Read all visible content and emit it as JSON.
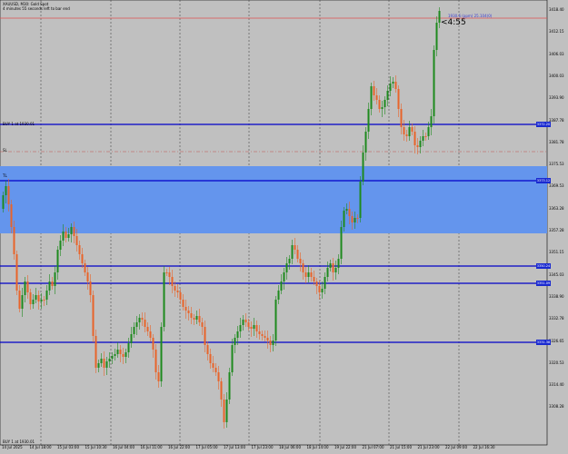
{
  "header": {
    "title": "XAUUSD, M30:  Gold Spot",
    "subtitle": "4 minutes 55 seconds left to bar end"
  },
  "countdown": "<4:55",
  "ask_note": "1930.6 (ppm) 25.104(0)",
  "lines": {
    "buy_label": "BUY 1 at 1930.01",
    "sl_label": "SL",
    "tp_label": "TL",
    "buy_bottom_label": "BUY 1 at 1930.01"
  },
  "price_axis": [
    {
      "value": "3418.40"
    },
    {
      "value": "3412.15"
    },
    {
      "value": "3406.03"
    },
    {
      "value": "3400.03"
    },
    {
      "value": "3393.90"
    },
    {
      "value": "3387.78"
    },
    {
      "value": "3381.78"
    },
    {
      "value": "3375.53"
    },
    {
      "value": "3369.53"
    },
    {
      "value": "3363.28"
    },
    {
      "value": "3357.28"
    },
    {
      "value": "3351.15"
    },
    {
      "value": "3345.03"
    },
    {
      "value": "3338.90"
    },
    {
      "value": "3332.78"
    },
    {
      "value": "3326.65"
    },
    {
      "value": "3320.53"
    },
    {
      "value": "3314.40"
    },
    {
      "value": "3308.28"
    }
  ],
  "price_tags": [
    "3372.20",
    "3373.12",
    "3350.24",
    "3351.09",
    "3331.38"
  ],
  "time_axis": [
    "14 Jul 2025",
    "14 Jul 18:00",
    "15 Jul 03:00",
    "15 Jul 10:30",
    "16 Jul 04:00",
    "16 Jul 11:00",
    "16 Jul 22:00",
    "17 Jul 05:00",
    "17 Jul 13:00",
    "17 Jul 23:00",
    "18 Jul 06:00",
    "18 Jul 14:00",
    "19 Jul 22:00",
    "21 Jul 07:00",
    "21 Jul 15:00",
    "21 Jul 23:00",
    "22 Jul 09:00",
    "22 Jul 16:30"
  ],
  "colors": {
    "background": "#c0c0c0",
    "bull": "#1e8a1e",
    "bear": "#e8642a",
    "zone": "#6495ed",
    "hline": "#0000c8",
    "ask": "#e05050"
  }
}
